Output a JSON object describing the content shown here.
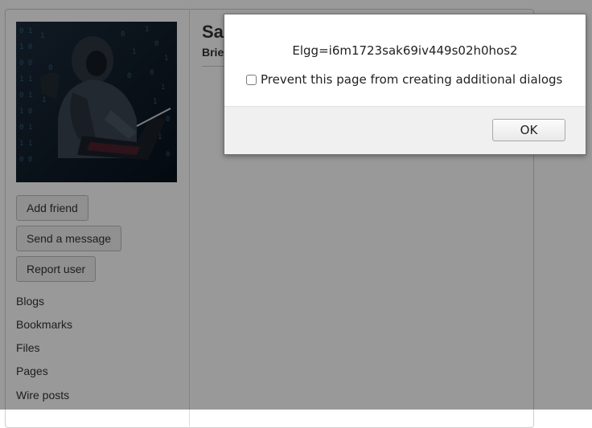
{
  "profile": {
    "name": "Samy",
    "brief": "Brief description"
  },
  "actions": {
    "add_friend": "Add friend",
    "send_message": "Send a message",
    "report_user": "Report user"
  },
  "owner_nav": {
    "items": [
      "Blogs",
      "Bookmarks",
      "Files",
      "Pages",
      "Wire posts"
    ]
  },
  "alert_dialog": {
    "message": "Elgg=i6m1723sak69iv449s02h0hos2",
    "suppress_label": "Prevent this page from creating additional dialogs",
    "suppress_checked": false,
    "ok_label": "OK"
  }
}
